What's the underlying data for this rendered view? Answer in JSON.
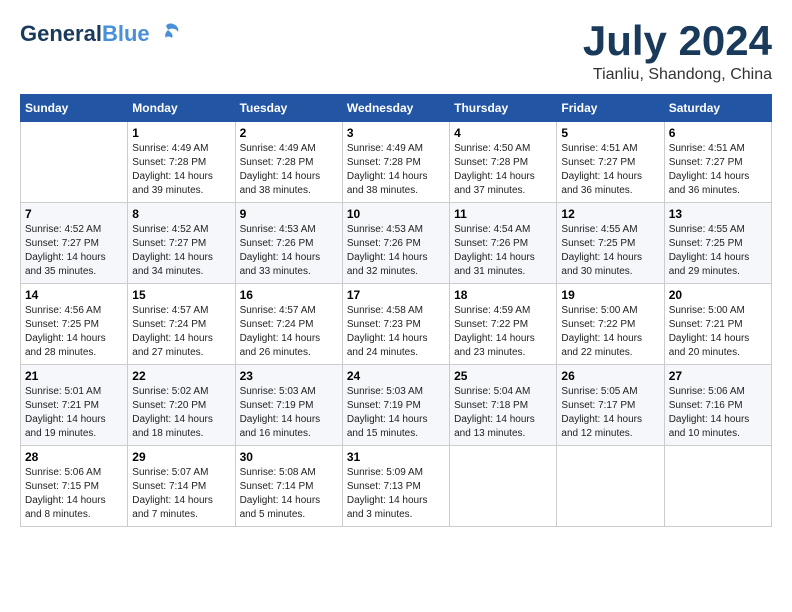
{
  "header": {
    "logo_general": "General",
    "logo_blue": "Blue",
    "month_year": "July 2024",
    "location": "Tianliu, Shandong, China"
  },
  "columns": [
    "Sunday",
    "Monday",
    "Tuesday",
    "Wednesday",
    "Thursday",
    "Friday",
    "Saturday"
  ],
  "weeks": [
    [
      {
        "day": "",
        "empty": true
      },
      {
        "day": "1",
        "sunrise": "4:49 AM",
        "sunset": "7:28 PM",
        "daylight": "14 hours and 39 minutes."
      },
      {
        "day": "2",
        "sunrise": "4:49 AM",
        "sunset": "7:28 PM",
        "daylight": "14 hours and 38 minutes."
      },
      {
        "day": "3",
        "sunrise": "4:49 AM",
        "sunset": "7:28 PM",
        "daylight": "14 hours and 38 minutes."
      },
      {
        "day": "4",
        "sunrise": "4:50 AM",
        "sunset": "7:28 PM",
        "daylight": "14 hours and 37 minutes."
      },
      {
        "day": "5",
        "sunrise": "4:51 AM",
        "sunset": "7:27 PM",
        "daylight": "14 hours and 36 minutes."
      },
      {
        "day": "6",
        "sunrise": "4:51 AM",
        "sunset": "7:27 PM",
        "daylight": "14 hours and 36 minutes."
      }
    ],
    [
      {
        "day": "7",
        "sunrise": "4:52 AM",
        "sunset": "7:27 PM",
        "daylight": "14 hours and 35 minutes."
      },
      {
        "day": "8",
        "sunrise": "4:52 AM",
        "sunset": "7:27 PM",
        "daylight": "14 hours and 34 minutes."
      },
      {
        "day": "9",
        "sunrise": "4:53 AM",
        "sunset": "7:26 PM",
        "daylight": "14 hours and 33 minutes."
      },
      {
        "day": "10",
        "sunrise": "4:53 AM",
        "sunset": "7:26 PM",
        "daylight": "14 hours and 32 minutes."
      },
      {
        "day": "11",
        "sunrise": "4:54 AM",
        "sunset": "7:26 PM",
        "daylight": "14 hours and 31 minutes."
      },
      {
        "day": "12",
        "sunrise": "4:55 AM",
        "sunset": "7:25 PM",
        "daylight": "14 hours and 30 minutes."
      },
      {
        "day": "13",
        "sunrise": "4:55 AM",
        "sunset": "7:25 PM",
        "daylight": "14 hours and 29 minutes."
      }
    ],
    [
      {
        "day": "14",
        "sunrise": "4:56 AM",
        "sunset": "7:25 PM",
        "daylight": "14 hours and 28 minutes."
      },
      {
        "day": "15",
        "sunrise": "4:57 AM",
        "sunset": "7:24 PM",
        "daylight": "14 hours and 27 minutes."
      },
      {
        "day": "16",
        "sunrise": "4:57 AM",
        "sunset": "7:24 PM",
        "daylight": "14 hours and 26 minutes."
      },
      {
        "day": "17",
        "sunrise": "4:58 AM",
        "sunset": "7:23 PM",
        "daylight": "14 hours and 24 minutes."
      },
      {
        "day": "18",
        "sunrise": "4:59 AM",
        "sunset": "7:22 PM",
        "daylight": "14 hours and 23 minutes."
      },
      {
        "day": "19",
        "sunrise": "5:00 AM",
        "sunset": "7:22 PM",
        "daylight": "14 hours and 22 minutes."
      },
      {
        "day": "20",
        "sunrise": "5:00 AM",
        "sunset": "7:21 PM",
        "daylight": "14 hours and 20 minutes."
      }
    ],
    [
      {
        "day": "21",
        "sunrise": "5:01 AM",
        "sunset": "7:21 PM",
        "daylight": "14 hours and 19 minutes."
      },
      {
        "day": "22",
        "sunrise": "5:02 AM",
        "sunset": "7:20 PM",
        "daylight": "14 hours and 18 minutes."
      },
      {
        "day": "23",
        "sunrise": "5:03 AM",
        "sunset": "7:19 PM",
        "daylight": "14 hours and 16 minutes."
      },
      {
        "day": "24",
        "sunrise": "5:03 AM",
        "sunset": "7:19 PM",
        "daylight": "14 hours and 15 minutes."
      },
      {
        "day": "25",
        "sunrise": "5:04 AM",
        "sunset": "7:18 PM",
        "daylight": "14 hours and 13 minutes."
      },
      {
        "day": "26",
        "sunrise": "5:05 AM",
        "sunset": "7:17 PM",
        "daylight": "14 hours and 12 minutes."
      },
      {
        "day": "27",
        "sunrise": "5:06 AM",
        "sunset": "7:16 PM",
        "daylight": "14 hours and 10 minutes."
      }
    ],
    [
      {
        "day": "28",
        "sunrise": "5:06 AM",
        "sunset": "7:15 PM",
        "daylight": "14 hours and 8 minutes."
      },
      {
        "day": "29",
        "sunrise": "5:07 AM",
        "sunset": "7:14 PM",
        "daylight": "14 hours and 7 minutes."
      },
      {
        "day": "30",
        "sunrise": "5:08 AM",
        "sunset": "7:14 PM",
        "daylight": "14 hours and 5 minutes."
      },
      {
        "day": "31",
        "sunrise": "5:09 AM",
        "sunset": "7:13 PM",
        "daylight": "14 hours and 3 minutes."
      },
      {
        "day": "",
        "empty": true
      },
      {
        "day": "",
        "empty": true
      },
      {
        "day": "",
        "empty": true
      }
    ]
  ]
}
